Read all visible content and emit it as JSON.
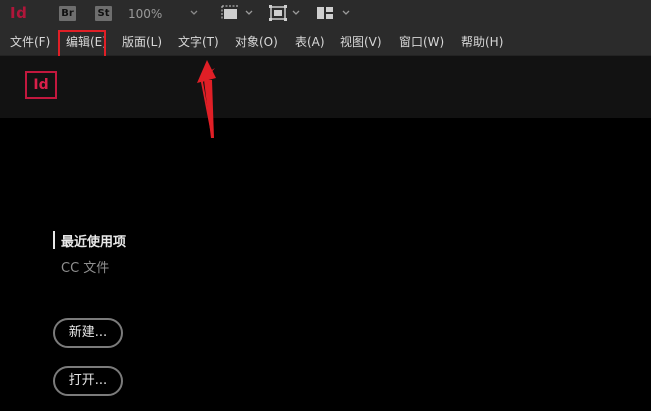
{
  "app": {
    "logo_text": "Id",
    "accent_color": "#b0163a"
  },
  "toolbar": {
    "bridge_badge": "Br",
    "stock_badge": "St",
    "zoom_value": "100%",
    "icons": [
      "screen-mode-icon",
      "view-options-icon",
      "workspace-icon",
      "chevron-down-icon"
    ]
  },
  "menu": {
    "items": [
      {
        "label": "文件(F)"
      },
      {
        "label": "编辑(E)"
      },
      {
        "label": "版面(L)"
      },
      {
        "label": "文字(T)"
      },
      {
        "label": "对象(O)"
      },
      {
        "label": "表(A)"
      },
      {
        "label": "视图(V)"
      },
      {
        "label": "窗口(W)"
      },
      {
        "label": "帮助(H)"
      }
    ],
    "highlight_color": "#e01f26"
  },
  "home": {
    "logo_text": "Id",
    "recent_label": "最近使用项",
    "cc_files_label": "CC 文件",
    "new_button": "新建...",
    "open_button": "打开..."
  }
}
